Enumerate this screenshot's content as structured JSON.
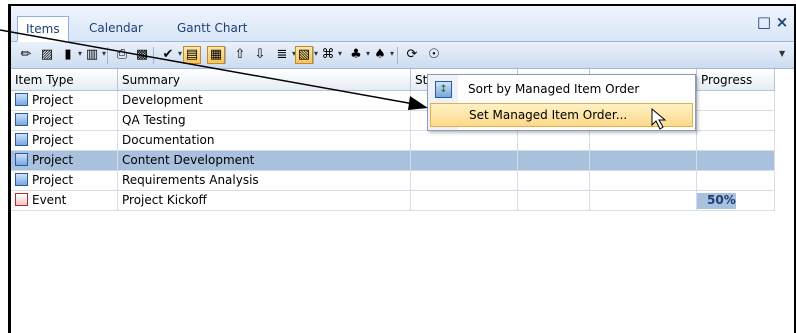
{
  "tabs": [
    {
      "label": "Items",
      "active": true
    },
    {
      "label": "Calendar",
      "active": false
    },
    {
      "label": "Gantt Chart",
      "active": false
    }
  ],
  "window_buttons": {
    "restore": "□",
    "close": "×"
  },
  "toolbar": {
    "buttons": [
      {
        "name": "pencil-icon",
        "glyph": "✏",
        "pressed": false
      },
      {
        "name": "edit-page-icon",
        "glyph": "▨",
        "pressed": false
      },
      {
        "name": "folder-icon",
        "glyph": "▮",
        "pressed": false
      },
      {
        "name": "new-item-icon",
        "glyph": "▥",
        "pressed": false
      },
      {
        "name": "print-icon",
        "glyph": "⎙",
        "pressed": false
      },
      {
        "name": "delete-icon",
        "glyph": "▩",
        "pressed": false
      },
      {
        "name": "checkmark-icon",
        "glyph": "✔",
        "pressed": false
      },
      {
        "name": "filter-icon",
        "glyph": "▤",
        "pressed": true
      },
      {
        "name": "paste-icon",
        "glyph": "▦",
        "pressed": true
      },
      {
        "name": "move-up-icon",
        "glyph": "⇧",
        "pressed": false
      },
      {
        "name": "move-down-icon",
        "glyph": "⇩",
        "pressed": false
      },
      {
        "name": "sort-icon",
        "glyph": "≣",
        "pressed": false
      },
      {
        "name": "managed-order-icon",
        "glyph": "▧",
        "pressed": true
      },
      {
        "name": "link-icon",
        "glyph": "⌘",
        "pressed": false
      },
      {
        "name": "add-resource-icon",
        "glyph": "♣",
        "pressed": false
      },
      {
        "name": "remove-resource-icon",
        "glyph": "♠",
        "pressed": false
      },
      {
        "name": "refresh-icon",
        "glyph": "⟳",
        "pressed": false
      },
      {
        "name": "find-icon",
        "glyph": "☉",
        "pressed": false
      }
    ]
  },
  "grid": {
    "columns": [
      "Item Type",
      "Summary",
      "St",
      "",
      "",
      "Progress"
    ],
    "rows": [
      {
        "type": "Project",
        "summary": "Development",
        "selected": false,
        "progress": ""
      },
      {
        "type": "Project",
        "summary": "QA Testing",
        "selected": false,
        "progress": ""
      },
      {
        "type": "Project",
        "summary": "Documentation",
        "selected": false,
        "progress": ""
      },
      {
        "type": "Project",
        "summary": "Content Development",
        "selected": true,
        "progress": ""
      },
      {
        "type": "Project",
        "summary": "Requirements Analysis",
        "selected": false,
        "progress": ""
      },
      {
        "type": "Event",
        "summary": "Project Kickoff",
        "selected": false,
        "progress": "50%",
        "progress_fraction": 0.5
      }
    ]
  },
  "context_menu": {
    "items": [
      {
        "label": "Sort by Managed Item Order",
        "hover": false
      },
      {
        "label": "Set Managed Item Order...",
        "hover": true
      }
    ]
  },
  "colors": {
    "accent": "#1e3f74",
    "selection": "#a9c1dd",
    "hover": "#fcd98a"
  }
}
